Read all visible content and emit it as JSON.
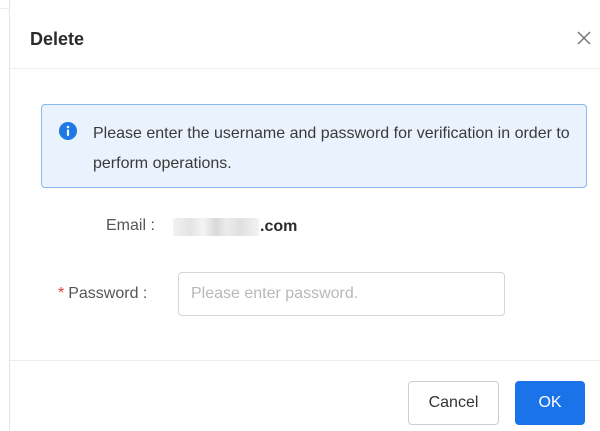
{
  "dialog": {
    "title": "Delete",
    "close_icon": "close-icon"
  },
  "notice": {
    "icon": "info-icon",
    "text": "Please enter the username and password for verification in order to perform operations.",
    "color": "#1e79e4"
  },
  "form": {
    "email_label": "Email :",
    "email_domain": ".com",
    "password_label": "Password :",
    "required_mark": "*",
    "password_placeholder": "Please enter password.",
    "password_value": ""
  },
  "footer": {
    "cancel_label": "Cancel",
    "ok_label": "OK"
  },
  "colors": {
    "primary": "#1a73e8",
    "required": "#e23a3a",
    "notice_bg": "#eaf3fd",
    "notice_border": "#8ab8ec"
  }
}
